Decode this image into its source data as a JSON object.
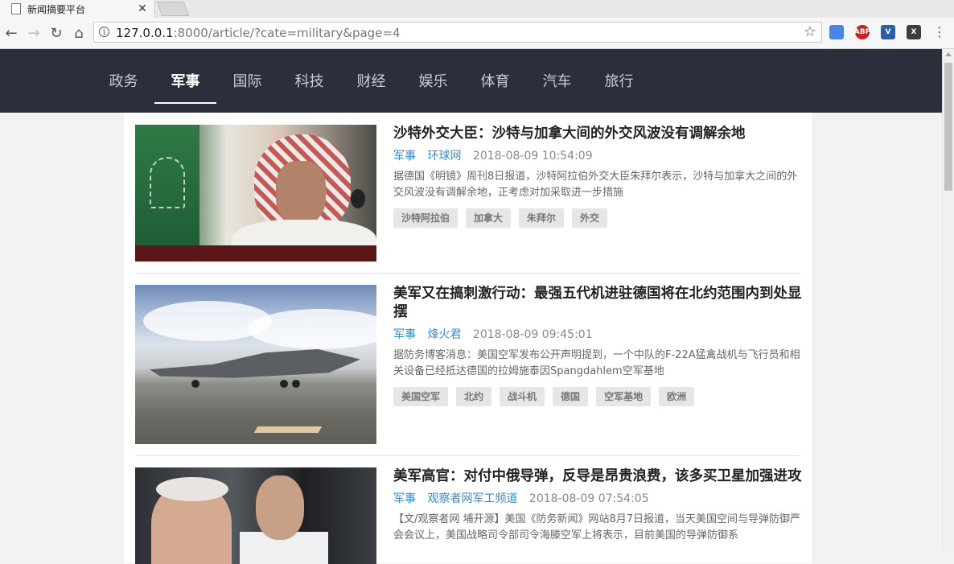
{
  "browser": {
    "tab_title": "新闻摘要平台",
    "url_host": "127.0.0.1",
    "url_rest": ":8000/article/?cate=military&page=4",
    "extensions": [
      {
        "icon": "translate-icon",
        "color": "#4a86e8"
      },
      {
        "icon": "adblock-icon",
        "color": "#c8221c",
        "label": "ABP"
      },
      {
        "icon": "vue-devtools-icon",
        "color": "#2a5fa8",
        "label": "V"
      },
      {
        "icon": "x-extension-icon",
        "color": "#3c3c3c",
        "label": "X"
      }
    ]
  },
  "nav": {
    "items": [
      "政务",
      "军事",
      "国际",
      "科技",
      "财经",
      "娱乐",
      "体育",
      "汽车",
      "旅行"
    ],
    "active": "军事"
  },
  "articles": [
    {
      "title": "沙特外交大臣：沙特与加拿大间的外交风波没有调解余地",
      "category": "军事",
      "source": "环球网",
      "time": "2018-08-09 10:54:09",
      "summary": "据德国《明镜》周刊8日报道，沙特阿拉伯外交大臣朱拜尔表示，沙特与加拿大之间的外交风波没有调解余地，正考虑对加采取进一步措施",
      "tags": [
        "沙特阿拉伯",
        "加拿大",
        "朱拜尔",
        "外交"
      ]
    },
    {
      "title": "美军又在搞刺激行动：最强五代机进驻德国将在北约范围内到处显摆",
      "category": "军事",
      "source": "烽火君",
      "time": "2018-08-09 09:45:01",
      "summary": "据防务博客消息：美国空军发布公开声明提到，一个中队的F-22A猛禽战机与飞行员和相关设备已经抵达德国的拉姆施泰因Spangdahlem空军基地",
      "tags": [
        "美国空军",
        "北约",
        "战斗机",
        "德国",
        "空军基地",
        "欧洲"
      ]
    },
    {
      "title": "美军高官：对付中俄导弹，反导是昂贵浪费，该多买卫星加强进攻",
      "category": "军事",
      "source": "观察者网军工频道",
      "time": "2018-08-09 07:54:05",
      "summary": "【文/观察者网 埔开源】美国《防务新闻》网站8月7日报道，当天美国空间与导弹防御严会会议上，美国战略司令部司令海滕空军上将表示，目前美国的导弹防御系",
      "tags": []
    }
  ]
}
